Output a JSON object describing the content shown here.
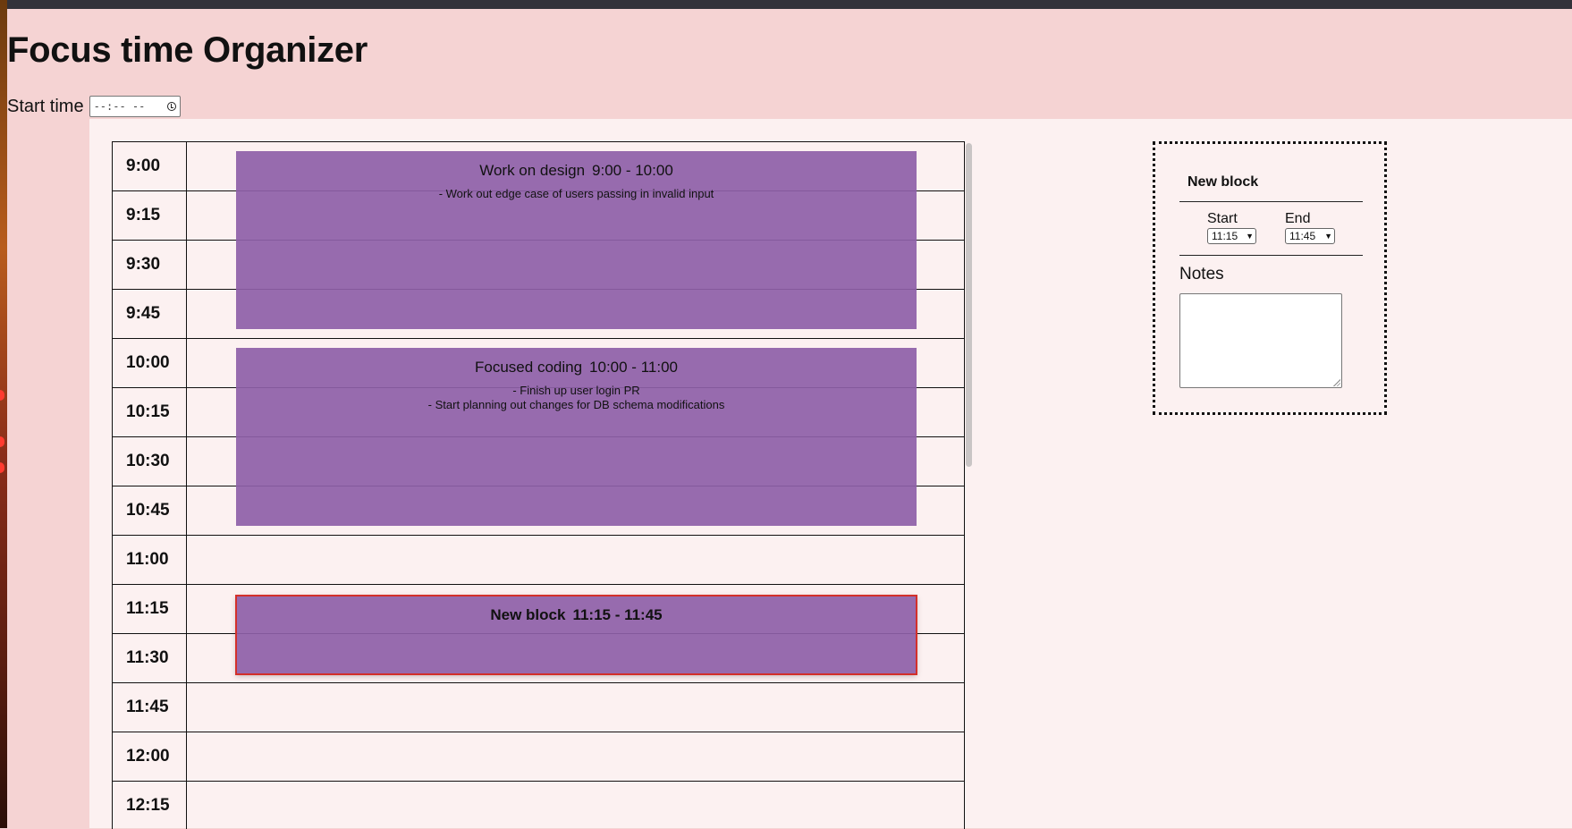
{
  "app": {
    "title": "Focus time Organizer"
  },
  "start_time": {
    "label": "Start time",
    "placeholder": "--:-- --"
  },
  "schedule": {
    "times": [
      "9:00",
      "9:15",
      "9:30",
      "9:45",
      "10:00",
      "10:15",
      "10:30",
      "10:45",
      "11:00",
      "11:15",
      "11:30",
      "11:45",
      "12:00",
      "12:15"
    ],
    "blocks": [
      {
        "name": "Work on design",
        "range": "9:00 - 10:00",
        "notes": "- Work out edge case of users passing in invalid input"
      },
      {
        "name": "Focused coding",
        "range": "10:00 - 11:00",
        "notes": "- Finish up user login PR\n- Start planning out changes for DB schema modifications"
      },
      {
        "name": "New block",
        "range": "11:15 - 11:45",
        "notes": ""
      }
    ]
  },
  "editor": {
    "title": "New block",
    "start_label": "Start",
    "start_value": "11:15",
    "end_label": "End",
    "end_value": "11:45",
    "notes_label": "Notes",
    "notes_value": ""
  },
  "colors": {
    "background": "#f5d3d3",
    "panel": "#fcf1f1",
    "block": "#8e60a8",
    "selected_border": "#d3302a"
  }
}
